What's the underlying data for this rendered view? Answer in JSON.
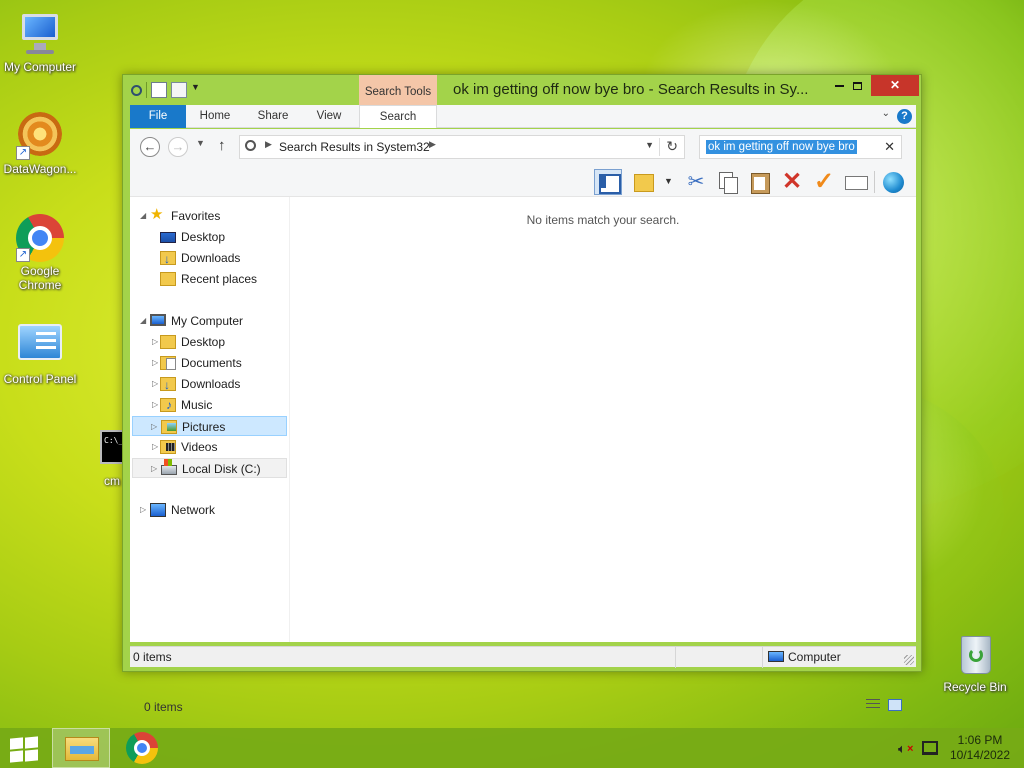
{
  "desktop": {
    "icons": [
      {
        "label": "My Computer"
      },
      {
        "label": "DataWagon..."
      },
      {
        "label": "Google Chrome"
      },
      {
        "label": "Control Panel"
      },
      {
        "label": "cm"
      },
      {
        "label": "Recycle Bin"
      }
    ]
  },
  "window": {
    "title": "ok im getting off now bye bro - Search Results in Sy...",
    "contextual_tab": "Search Tools",
    "tabs": [
      "File",
      "Home",
      "Share",
      "View",
      "Search"
    ],
    "address": {
      "crumb": "Search Results in System32"
    },
    "search": {
      "value": "ok im getting off now bye bro"
    },
    "nav": {
      "favorites": {
        "label": "Favorites",
        "items": [
          "Desktop",
          "Downloads",
          "Recent places"
        ]
      },
      "computer": {
        "label": "My Computer",
        "items": [
          "Desktop",
          "Documents",
          "Downloads",
          "Music",
          "Pictures",
          "Videos",
          "Local Disk (C:)"
        ],
        "selected": "Pictures"
      },
      "network": {
        "label": "Network"
      }
    },
    "empty_message": "No items match your search.",
    "item_count": "0 items",
    "status": {
      "left": "0 items",
      "right": "Computer"
    }
  },
  "taskbar": {
    "time": "1:06 PM",
    "date": "10/14/2022"
  },
  "colors": {
    "window_frame": "#a3d34a",
    "file_tab": "#1979ca",
    "close_button": "#c7352a",
    "contextual_tab": "#f4c6a8",
    "selection": "#cde8ff"
  }
}
